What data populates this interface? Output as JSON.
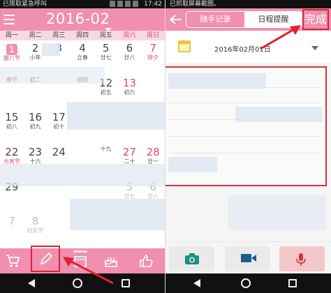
{
  "left": {
    "status_text": "已限取紧急呼叫",
    "time": "17:42",
    "month_title": "2016-02",
    "weekdays": [
      "周一",
      "周二",
      "周三",
      "周四",
      "周五",
      "周六",
      "周日"
    ],
    "weeks": [
      [
        {
          "d": "1",
          "l": "腊八节",
          "today": true
        },
        {
          "d": "2",
          "l": "小年"
        },
        {
          "d": "3",
          "l": ""
        },
        {
          "d": "4",
          "l": "立春"
        },
        {
          "d": "5",
          "l": "廿七"
        },
        {
          "d": "6",
          "l": "廿八"
        },
        {
          "d": "7",
          "l": "除夕",
          "red": true,
          "pink": true
        }
      ],
      [
        {
          "d": "",
          "l": "春节",
          "pink": true
        },
        {
          "d": "",
          "l": "初二"
        },
        {
          "d": "",
          "l": ""
        },
        {
          "d": "",
          "l": "初四"
        },
        {
          "d": "12",
          "l": "初五"
        },
        {
          "d": "13",
          "l": "初六",
          "red": true
        },
        {
          "d": "",
          "l": ""
        }
      ],
      [
        {
          "d": "15",
          "l": "初八"
        },
        {
          "d": "16",
          "l": "初九"
        },
        {
          "d": "17",
          "l": "初十"
        },
        {
          "d": "",
          "l": ""
        },
        {
          "d": "",
          "l": ""
        },
        {
          "d": "",
          "l": ""
        },
        {
          "d": "",
          "l": ""
        }
      ],
      [
        {
          "d": "22",
          "l": "元宵节",
          "pink": true
        },
        {
          "d": "23",
          "l": "十六"
        },
        {
          "d": "24",
          "l": ""
        },
        {
          "d": "",
          "l": ""
        },
        {
          "d": "",
          "l": "十九"
        },
        {
          "d": "27",
          "l": "二十",
          "red": true
        },
        {
          "d": "28",
          "l": "廿一",
          "red": true
        }
      ],
      [
        {
          "d": "29",
          "l": ""
        },
        {
          "d": "",
          "l": ""
        },
        {
          "d": "",
          "l": ""
        },
        {
          "d": "",
          "l": ""
        },
        {
          "d": "",
          "l": ""
        },
        {
          "d": "5",
          "l": "廿七",
          "faded": true
        },
        {
          "d": "6",
          "l": "廿八",
          "faded": true
        }
      ],
      [
        {
          "d": "7",
          "l": "",
          "faded": true
        },
        {
          "d": "8",
          "l": "妇女节",
          "faded": true,
          "pink": true
        },
        {
          "d": "",
          "l": ""
        },
        {
          "d": "",
          "l": ""
        },
        {
          "d": "",
          "l": ""
        },
        {
          "d": "",
          "l": ""
        },
        {
          "d": "",
          "l": ""
        }
      ]
    ],
    "dock_icons": [
      "cart-icon",
      "pencil-icon",
      "calendar-icon",
      "cake-icon",
      "thumbs-up-icon"
    ]
  },
  "right": {
    "status_text": "已抓取屏幕截图。",
    "tabs": [
      {
        "label": "随手记录",
        "active": true
      },
      {
        "label": "日程提醒",
        "active": false
      }
    ],
    "done_label": "完成",
    "date_text": "2016年02月01日",
    "attach_icons": [
      "camera-icon",
      "video-icon",
      "microphone-icon"
    ]
  },
  "colors": {
    "brand_pink": "#f08fb0",
    "highlight_red": "#e0202e",
    "holiday_red": "#d94a6c"
  }
}
